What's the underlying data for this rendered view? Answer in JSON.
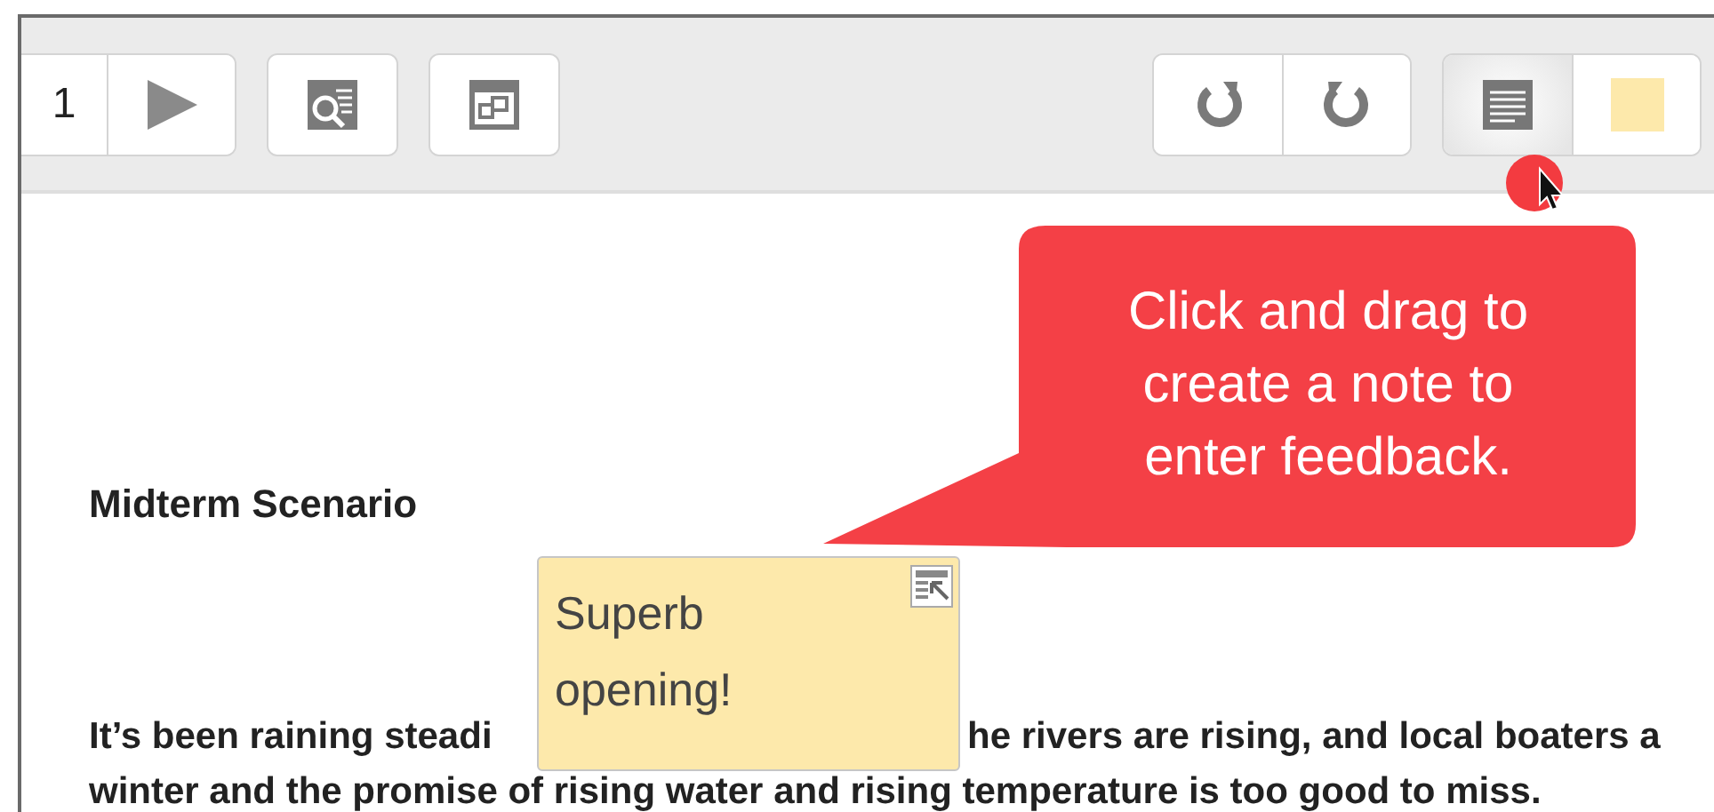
{
  "toolbar": {
    "left_groups": [
      {
        "buttons": [
          {
            "kind": "page",
            "text": "1",
            "selected": false
          },
          {
            "kind": "next",
            "selected": false
          }
        ]
      },
      {
        "buttons": [
          {
            "kind": "search",
            "selected": false
          }
        ]
      },
      {
        "buttons": [
          {
            "kind": "fit",
            "selected": false
          }
        ]
      }
    ],
    "right_groups": [
      {
        "buttons": [
          {
            "kind": "rotate-left",
            "selected": false
          },
          {
            "kind": "rotate-right",
            "selected": false
          }
        ]
      },
      {
        "buttons": [
          {
            "kind": "note",
            "selected": true
          },
          {
            "kind": "swatch",
            "selected": false
          }
        ]
      }
    ]
  },
  "document": {
    "heading": "Midterm Scenario",
    "lines": [
      [
        "It’s been raining steadi",
        "he rivers are rising, and local boaters a"
      ],
      [
        "winter and the promise of rising water and rising temperature is too good to miss."
      ]
    ]
  },
  "callout": {
    "text": "Click and drag to create a note to enter feedback."
  },
  "note": {
    "text": "Superb opening!"
  }
}
